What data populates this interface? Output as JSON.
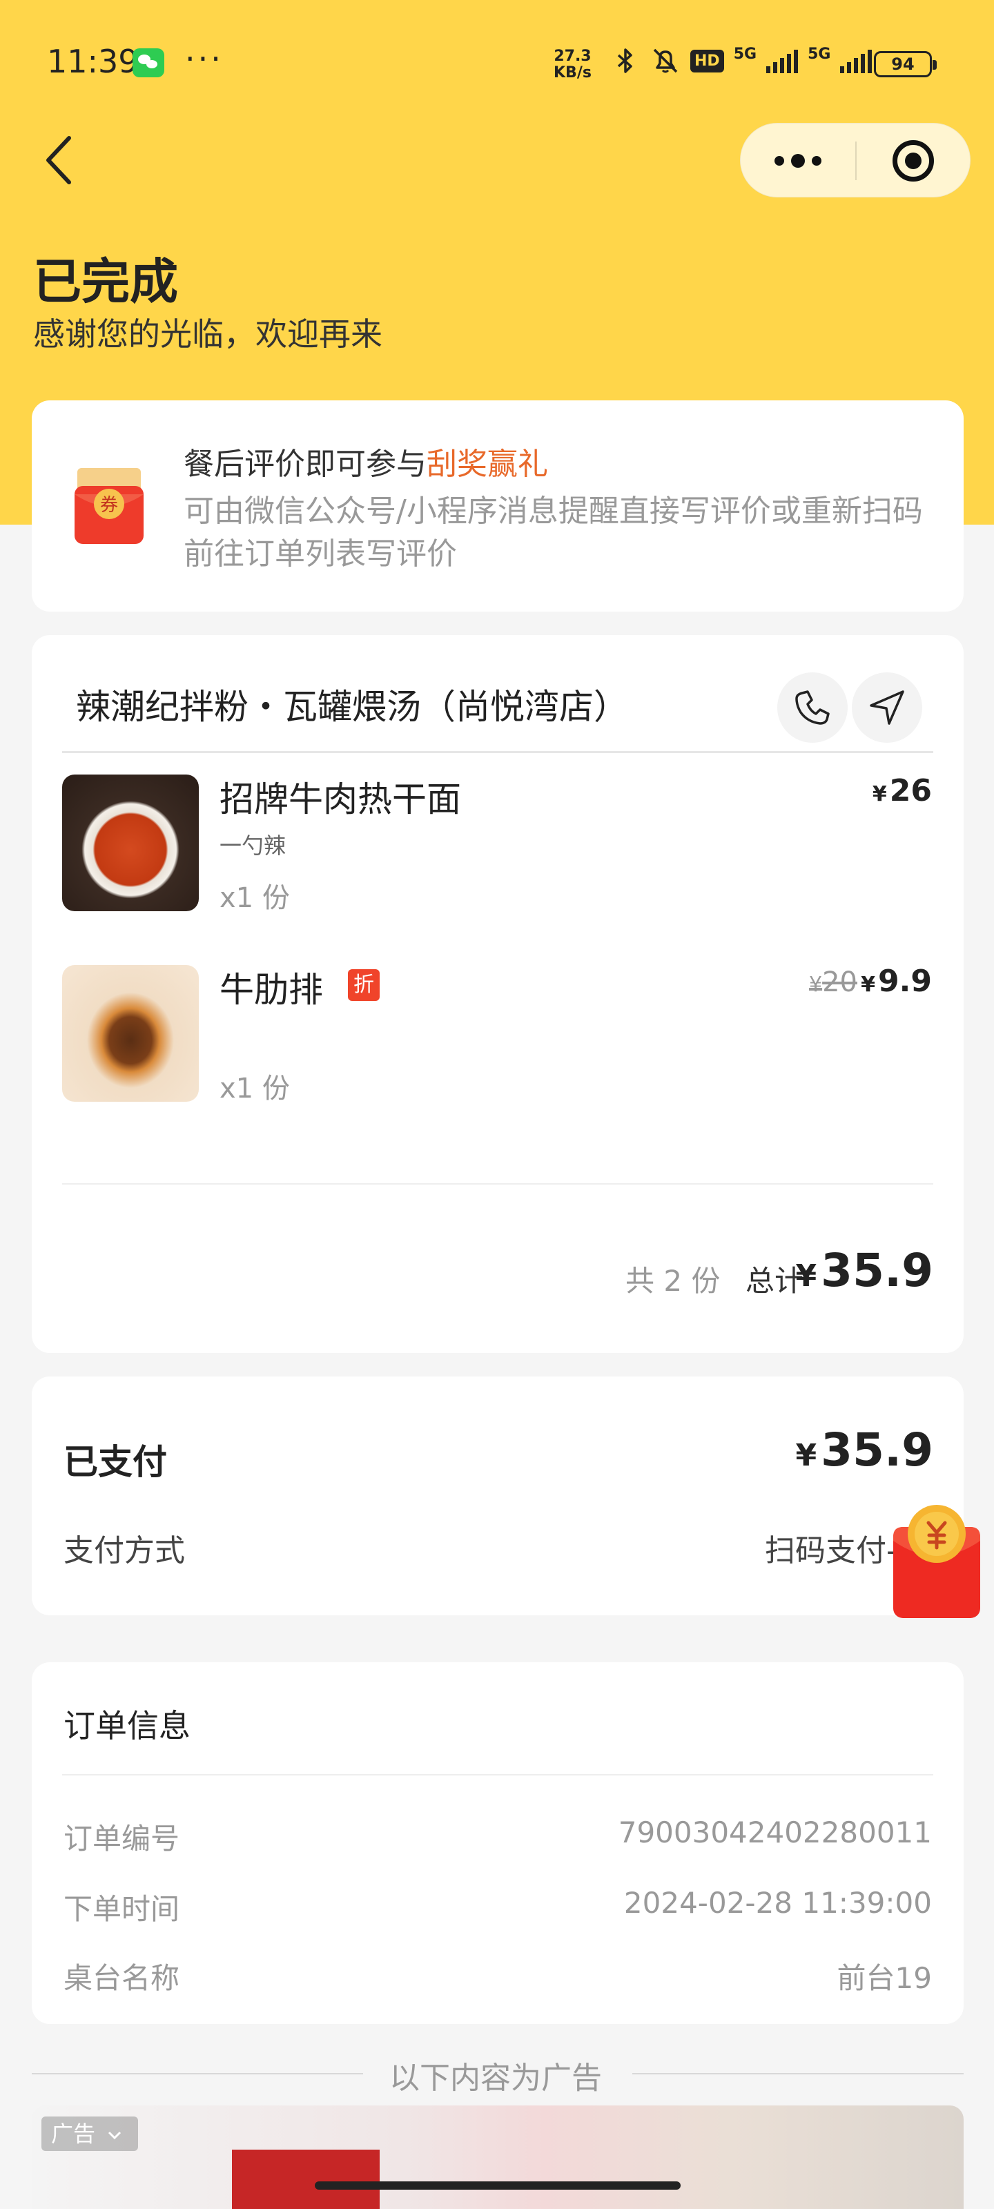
{
  "status_bar": {
    "time": "11:39",
    "dots": "···",
    "net_speed_value": "27.3",
    "net_speed_unit": "KB/s",
    "hd_label": "HD",
    "sig1_label": "5G",
    "sig2_label": "5G",
    "battery": "94"
  },
  "header": {
    "title": "已完成",
    "subtitle": "感谢您的光临，欢迎再来"
  },
  "review": {
    "title_prefix": "餐后评价即可参与",
    "title_highlight": "刮奖赢礼",
    "description": "可由微信公众号/小程序消息提醒直接写评价或重新扫码前往订单列表写评价",
    "coupon_text": "券"
  },
  "order": {
    "store_name": "辣潮纪拌粉・瓦罐煨汤（尚悦湾店）",
    "items": [
      {
        "name": "招牌牛肉热干面",
        "spec": "一勺辣",
        "qty": "x1 份",
        "price": "26",
        "currency": "¥"
      },
      {
        "name": "牛肋排",
        "badge": "折",
        "qty": "x1 份",
        "original_price": "20",
        "price": "9.9",
        "currency": "¥"
      }
    ],
    "count_label": "共 2 份",
    "total_label": "总计",
    "total_value": "35.9",
    "currency": "¥"
  },
  "payment": {
    "status": "已支付",
    "amount": "35.9",
    "currency": "¥",
    "method_label": "支付方式",
    "method_value": "扫码支付-微信"
  },
  "order_info": {
    "title": "订单信息",
    "rows": [
      {
        "label": "订单编号",
        "value": "79003042402280011"
      },
      {
        "label": "下单时间",
        "value": "2024-02-28 11:39:00"
      },
      {
        "label": "桌台名称",
        "value": "前台19"
      }
    ]
  },
  "ads": {
    "separator": "以下内容为广告",
    "tag": "广告"
  },
  "colors": {
    "hero": "#ffd64a",
    "highlight": "#e8692a",
    "badge": "#f0442a"
  }
}
